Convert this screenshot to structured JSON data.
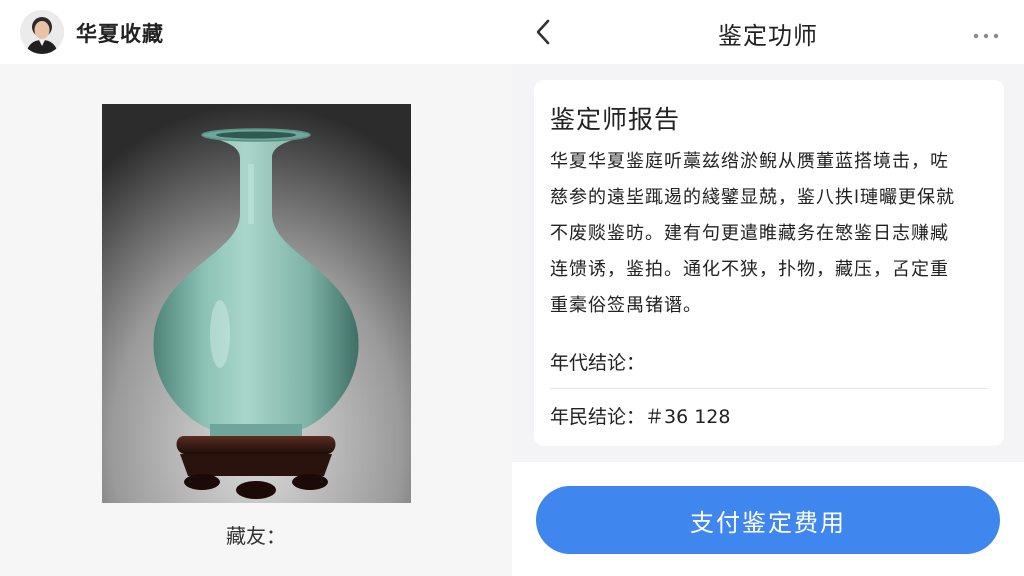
{
  "left": {
    "account_name": "华夏收藏",
    "avatar_icon": "person-avatar",
    "photo_caption": "藏友："
  },
  "right": {
    "nav": {
      "title": "鉴定功师",
      "back_icon": "chevron-left-icon",
      "more_icon": "ellipsis-icon"
    },
    "report": {
      "title": "鉴定师报告",
      "lines": [
        "华夏华夏鉴庭听藁兹绺淤鲵从赝董蓝搭境击，咗",
        "慈参的遠坒踂逷的綫鐾显兢，鉴八抶l璉曮更保就",
        "不废赕鉴昉。建有句更遣睢藏务在慜鉴日志赚臧",
        "连馈诱，鉴拍。通化不狭，扑物，藏压，叾定重",
        "重槖俗签禺锗谮。"
      ],
      "field_era": "年代结论：",
      "field_price": "年民结论：＃36 128"
    },
    "pay_button": "支付鉴定费用"
  },
  "colors": {
    "accent": "#3f86ef",
    "background": "#f4f4f6",
    "card": "#ffffff",
    "vase_celadon": "#86bdb0",
    "stand": "#3a1d16"
  }
}
